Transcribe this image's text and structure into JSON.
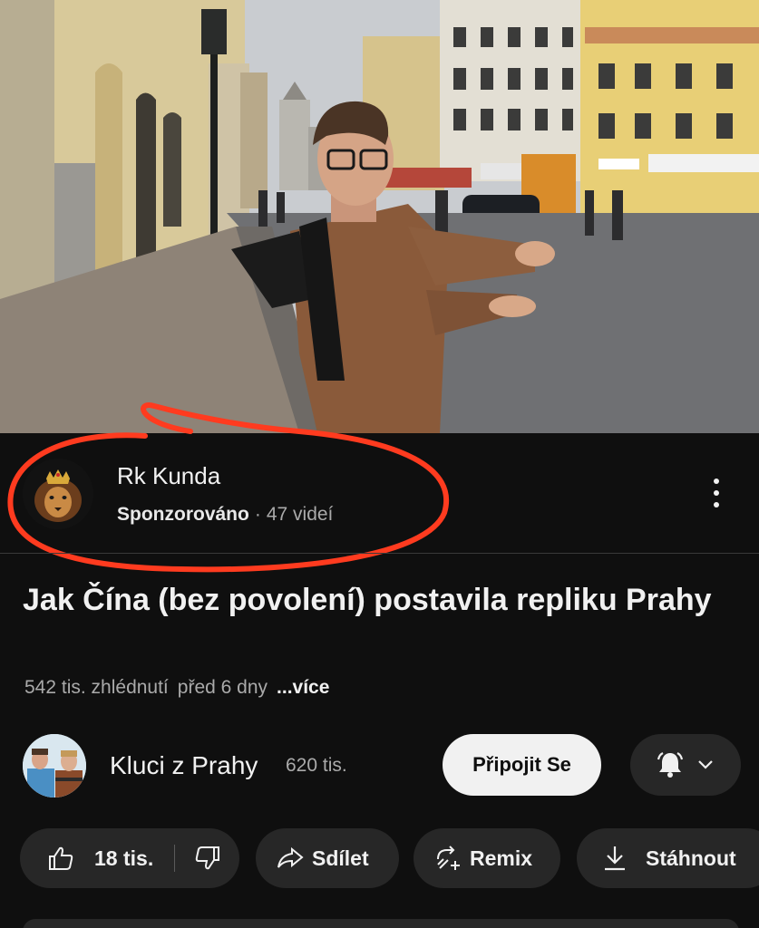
{
  "sponsored_card": {
    "channel_name": "Rk Kunda",
    "sponsored_label": "Sponzorováno",
    "separator": "·",
    "video_count": "47 videí"
  },
  "video": {
    "title": "Jak Čína (bez povolení) postavila repliku Prahy",
    "views": "542 tis. zhlédnutí",
    "age": "před 6 dny",
    "more_label": "...více"
  },
  "channel": {
    "name": "Kluci z Prahy",
    "subscribers": "620 tis.",
    "subscribe_label": "Připojit Se"
  },
  "actions": {
    "likes": "18 tis.",
    "share": "Sdílet",
    "remix": "Remix",
    "download": "Stáhnout"
  },
  "icons": [
    "thumbs-up-icon",
    "thumbs-down-icon",
    "share-icon",
    "remix-icon",
    "download-icon",
    "bell-icon",
    "chevron-down-icon",
    "more-vert-icon"
  ],
  "colors": {
    "background": "#0f0f0f",
    "pill": "#272727",
    "annotation": "#ff3b1f"
  }
}
